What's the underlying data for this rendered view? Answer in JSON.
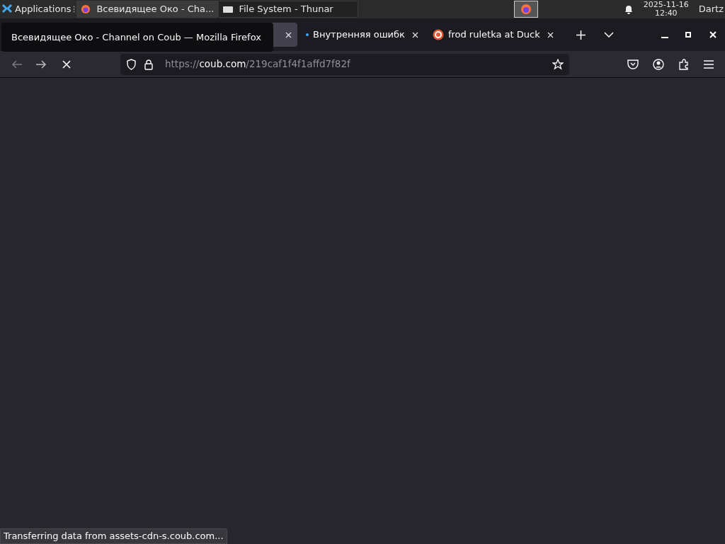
{
  "taskbar": {
    "menu_label": "Applications",
    "windows": [
      {
        "title": "Всевидящее Око - Cha...",
        "kind": "firefox",
        "selected": true
      },
      {
        "title": "File System - Thunar",
        "kind": "folder",
        "selected": false
      }
    ],
    "date": "2025-11-16",
    "time": "12:40",
    "user": "Dartz"
  },
  "tooltip": "Всевидящее Око - Channel on Coub — Mozilla Firefox",
  "tabs": [
    {
      "kind": "hidden",
      "selected": true
    },
    {
      "kind": "dot",
      "title": "Внутренняя ошибк",
      "selected": false
    },
    {
      "kind": "duck",
      "title": "frod ruletka at Duck",
      "selected": false
    }
  ],
  "address": {
    "scheme": "https://",
    "host": "coub.com",
    "path": "/219caf1f4f1affd7f82f"
  },
  "status": "Transferring data from assets-cdn-s.coub.com..."
}
